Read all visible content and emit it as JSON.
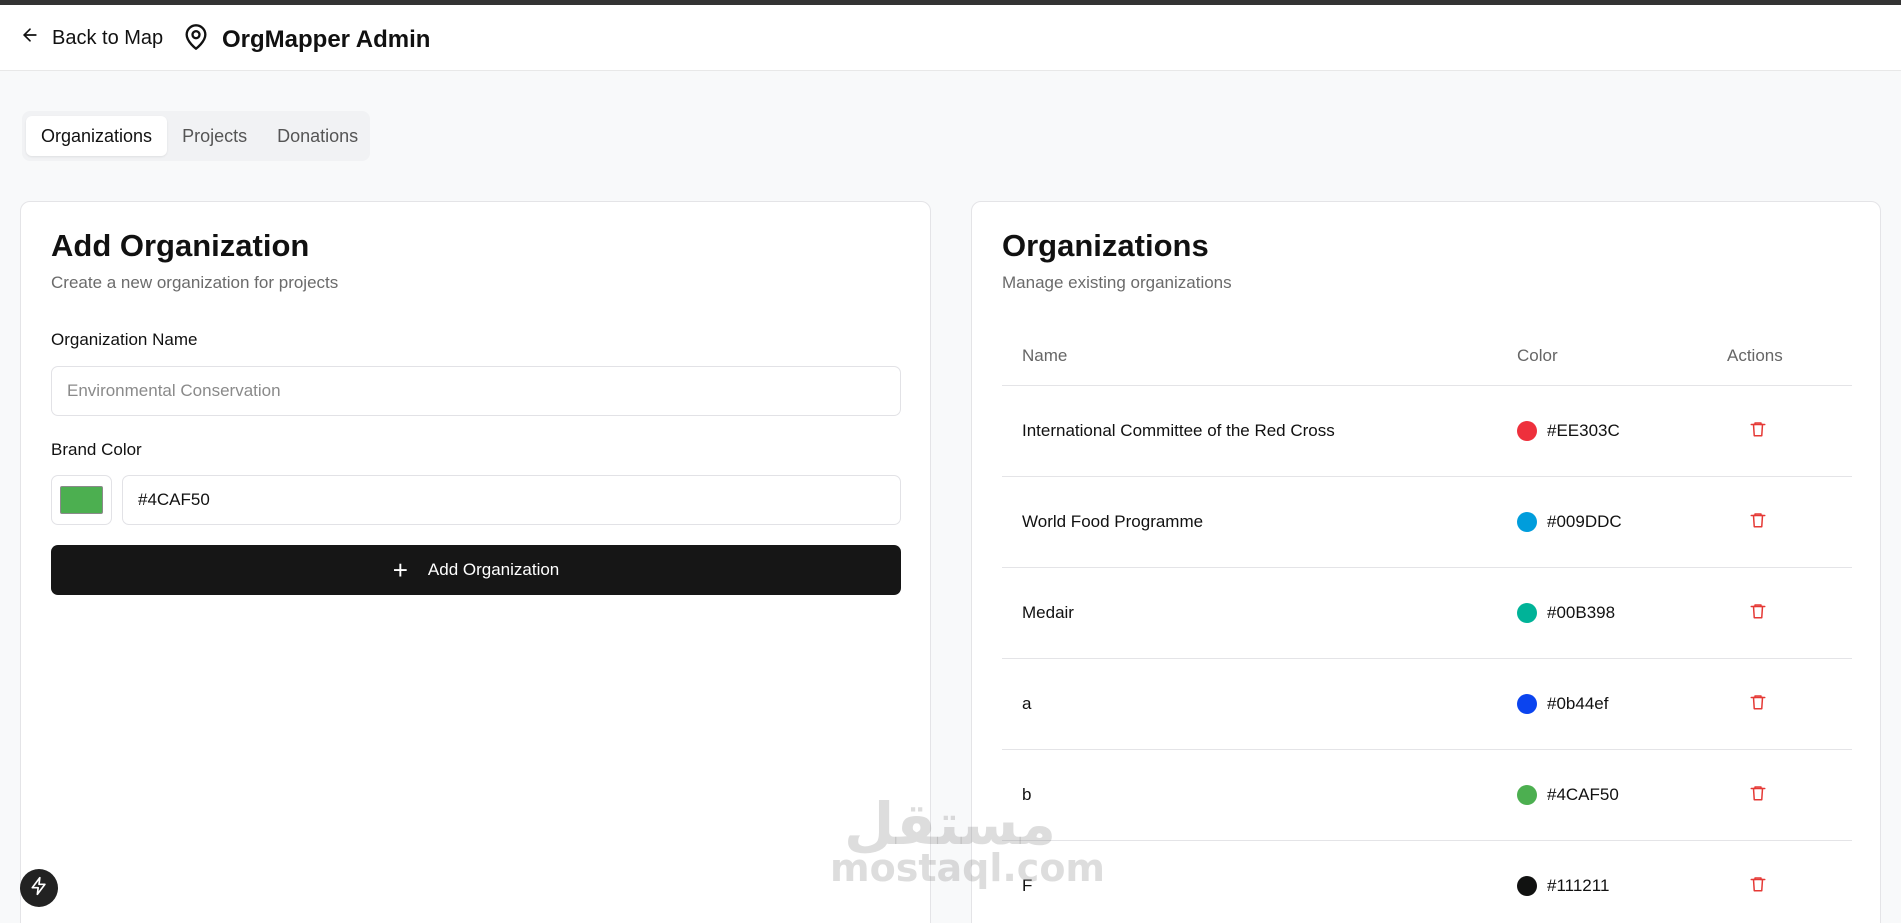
{
  "header": {
    "back_label": "Back to Map",
    "app_title": "OrgMapper Admin"
  },
  "tabs": [
    {
      "label": "Organizations",
      "active": true
    },
    {
      "label": "Projects",
      "active": false
    },
    {
      "label": "Donations",
      "active": false
    }
  ],
  "add_form": {
    "title": "Add Organization",
    "subtitle": "Create a new organization for projects",
    "name_label": "Organization Name",
    "name_placeholder": "Environmental Conservation",
    "name_value": "",
    "color_label": "Brand Color",
    "color_value": "#4CAF50",
    "swatch_color": "#4CAF50",
    "submit_label": "Add Organization"
  },
  "list": {
    "title": "Organizations",
    "subtitle": "Manage existing organizations",
    "columns": {
      "name": "Name",
      "color": "Color",
      "actions": "Actions"
    },
    "rows": [
      {
        "name": "International Committee of the Red Cross",
        "color": "#EE303C"
      },
      {
        "name": "World Food Programme",
        "color": "#009DDC"
      },
      {
        "name": "Medair",
        "color": "#00B398"
      },
      {
        "name": "a",
        "color": "#0b44ef"
      },
      {
        "name": "b",
        "color": "#4CAF50"
      },
      {
        "name": "F",
        "color": "#111211"
      }
    ]
  },
  "watermark": {
    "arabic": "مستقل",
    "latin": "mostaql.com"
  },
  "colors": {
    "danger": "#E53935",
    "primary": "#161616"
  }
}
